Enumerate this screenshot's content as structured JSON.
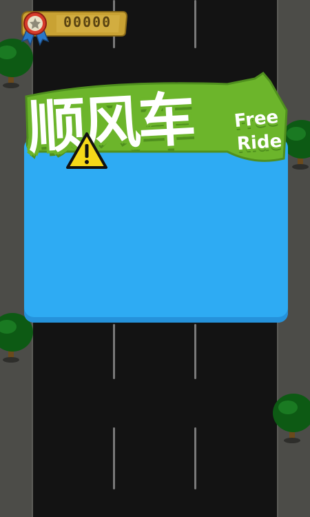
{
  "hud": {
    "score": "00000",
    "medal_icon": "ribbon-medal-icon"
  },
  "title": {
    "chinese": "顺风车",
    "english_line1": "Free",
    "english_line2": "Ride",
    "warning_icon": "warning-triangle-icon"
  },
  "colors": {
    "road": "#131313",
    "sidewalk": "#4c4c48",
    "panel": "#2eabf3",
    "logo_outline": "#6cb52b",
    "tree": "#0d5a14",
    "score_panel": "#c9a233"
  }
}
